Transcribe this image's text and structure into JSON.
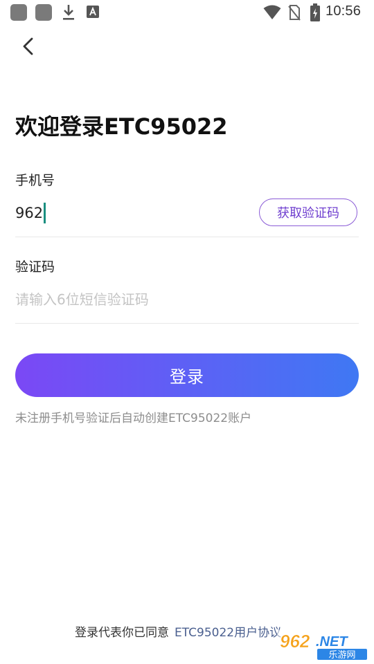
{
  "status_bar": {
    "time": "10:56",
    "icons": [
      "app-icon",
      "app-icon",
      "download-icon",
      "a-icon",
      "wifi-icon",
      "no-sim-icon",
      "battery-charging-icon"
    ]
  },
  "header": {
    "back_icon": "chevron-left-icon"
  },
  "title": "欢迎登录ETC95022",
  "phone": {
    "label": "手机号",
    "value": "962",
    "get_code_label": "获取验证码"
  },
  "code": {
    "label": "验证码",
    "placeholder": "请输入6位短信验证码",
    "value": ""
  },
  "login_button": "登录",
  "hint": "未注册手机号验证后自动创建ETC95022账户",
  "agreement": {
    "prefix": "登录代表你已同意",
    "link": "ETC95022用户协议"
  },
  "colors": {
    "accent": "#6f3fcf",
    "gradient_start": "#7b48f5",
    "gradient_end": "#3f78f3",
    "caret": "#1a8f80",
    "link": "#4a5f8f"
  },
  "watermark": {
    "logo_text": "962.NET",
    "sub_text": "乐游网"
  }
}
